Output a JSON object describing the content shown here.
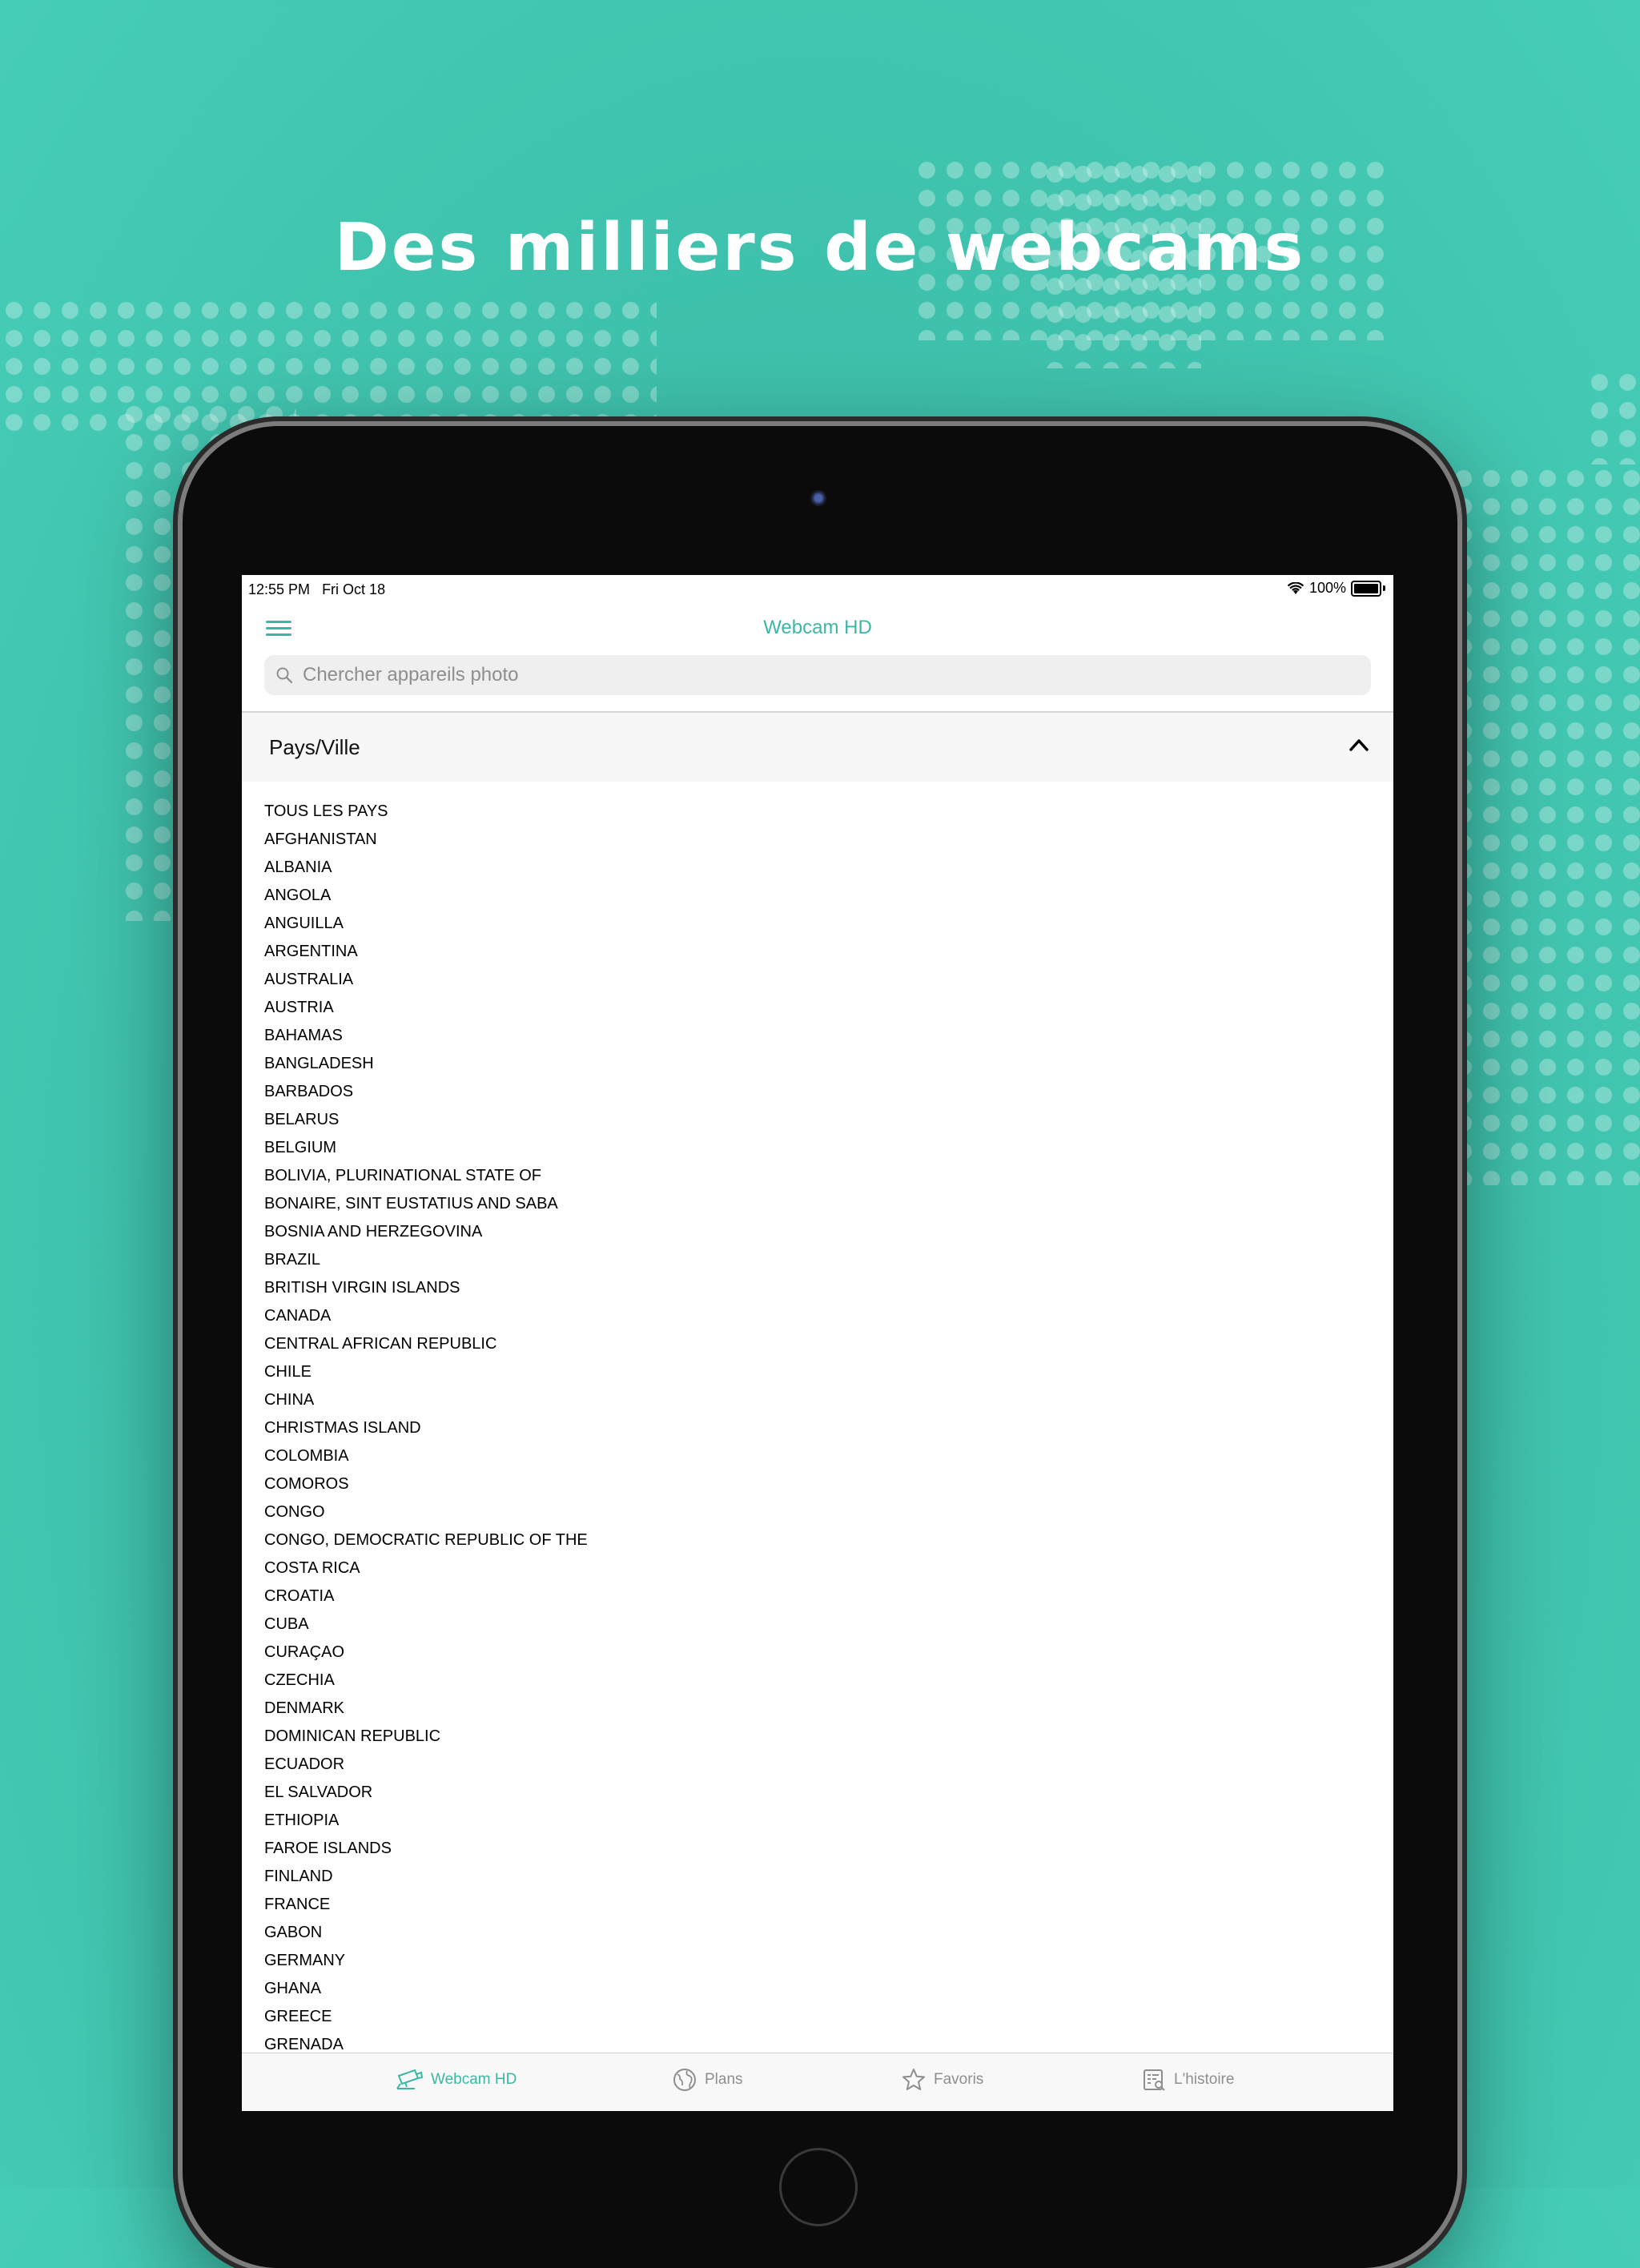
{
  "headline": "Des milliers de webcams",
  "status": {
    "time": "12:55 PM",
    "date": "Fri Oct 18",
    "battery": "100%"
  },
  "app": {
    "title": "Webcam HD",
    "accent": "#3bb7a4"
  },
  "search": {
    "placeholder": "Chercher appareils photo"
  },
  "section": {
    "title": "Pays/Ville"
  },
  "countries": [
    "TOUS LES PAYS",
    "AFGHANISTAN",
    "ALBANIA",
    "ANGOLA",
    "ANGUILLA",
    "ARGENTINA",
    "AUSTRALIA",
    "AUSTRIA",
    "BAHAMAS",
    "BANGLADESH",
    "BARBADOS",
    "BELARUS",
    "BELGIUM",
    "BOLIVIA, PLURINATIONAL STATE OF",
    "BONAIRE, SINT EUSTATIUS AND SABA",
    "BOSNIA AND HERZEGOVINA",
    "BRAZIL",
    "BRITISH VIRGIN ISLANDS",
    "CANADA",
    "CENTRAL AFRICAN REPUBLIC",
    "CHILE",
    "CHINA",
    "CHRISTMAS ISLAND",
    "COLOMBIA",
    "COMOROS",
    "CONGO",
    "CONGO, DEMOCRATIC REPUBLIC OF THE",
    "COSTA RICA",
    "CROATIA",
    "CUBA",
    "CURAÇAO",
    "CZECHIA",
    "DENMARK",
    "DOMINICAN REPUBLIC",
    "ECUADOR",
    "EL SALVADOR",
    "ETHIOPIA",
    "FAROE ISLANDS",
    "FINLAND",
    "FRANCE",
    "GABON",
    "GERMANY",
    "GHANA",
    "GREECE",
    "GRENADA"
  ],
  "tabs": [
    {
      "label": "Webcam HD",
      "icon": "camera-icon",
      "active": true
    },
    {
      "label": "Plans",
      "icon": "globe-icon",
      "active": false
    },
    {
      "label": "Favoris",
      "icon": "star-icon",
      "active": false
    },
    {
      "label": "L'histoire",
      "icon": "history-icon",
      "active": false
    }
  ]
}
